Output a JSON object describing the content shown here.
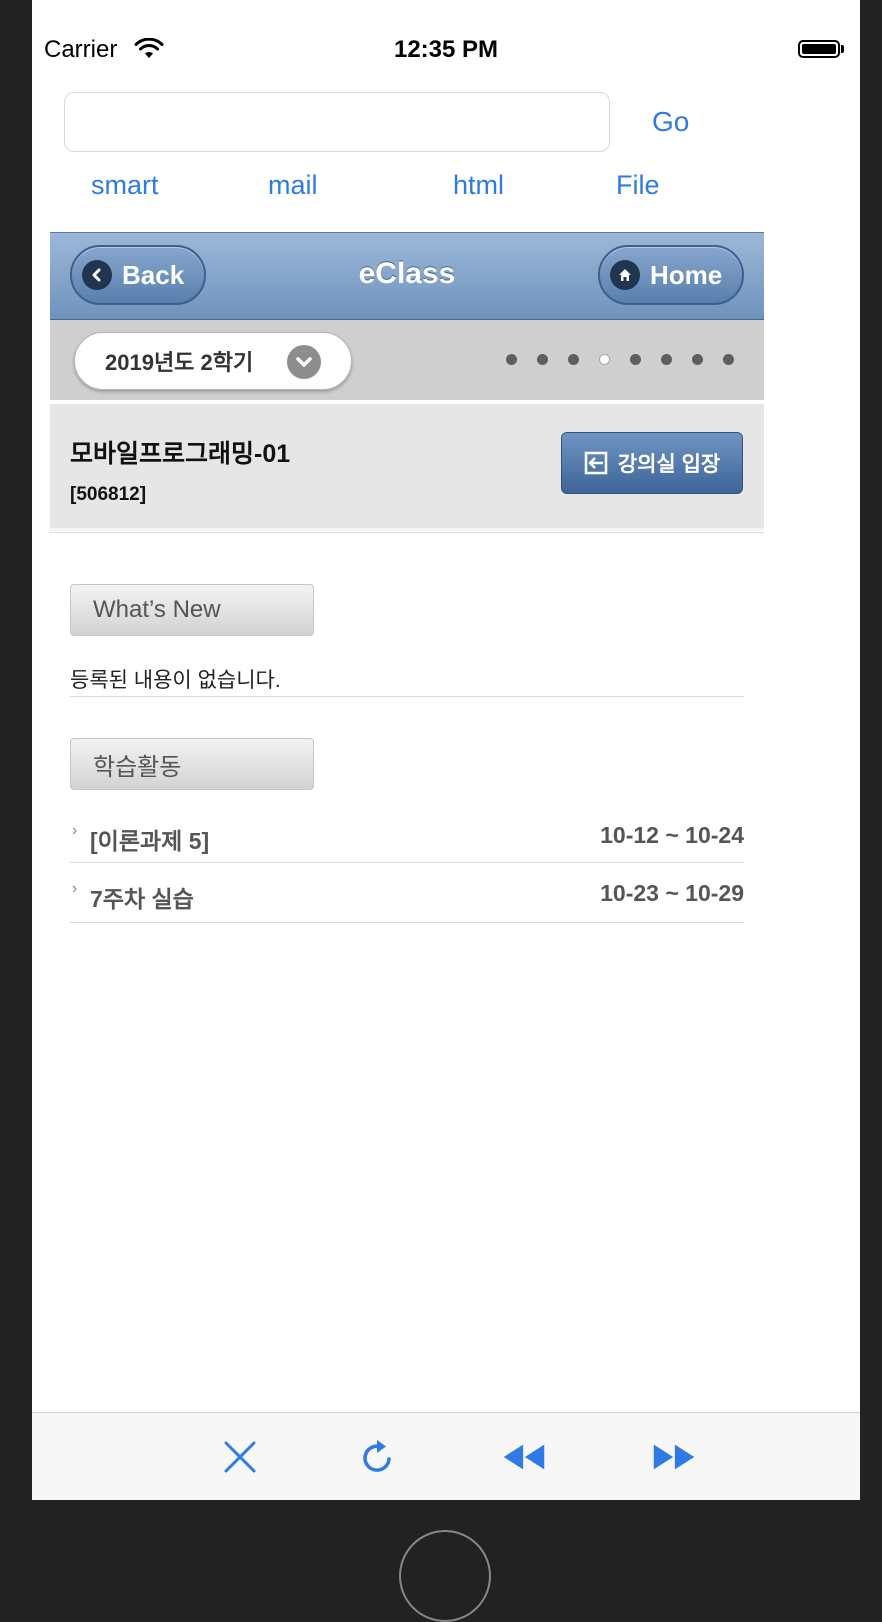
{
  "status_bar": {
    "carrier": "Carrier",
    "time": "12:35 PM"
  },
  "url_bar": {
    "value": "",
    "go_label": "Go"
  },
  "quick_links": [
    "smart",
    "mail",
    "html",
    "File"
  ],
  "nav": {
    "back_label": "Back",
    "title": "eClass",
    "home_label": "Home"
  },
  "semester": {
    "selected": "2019년도 2학기",
    "page_count": 8,
    "active_page": 4
  },
  "course": {
    "name": "모바일프로그래밍-01",
    "code": "[506812]",
    "enter_label": "강의실 입장"
  },
  "whats_new": {
    "heading": "What’s New",
    "empty_message": "등록된 내용이 없습니다."
  },
  "activities": {
    "heading": "학습활동",
    "items": [
      {
        "title": "[이론과제 5]",
        "period": "10-12 ~ 10-24"
      },
      {
        "title": "7주차 실습",
        "period": "10-23 ~ 10-29"
      }
    ]
  },
  "toolbar": {
    "icons": [
      "close-icon",
      "reload-icon",
      "rewind-icon",
      "fast-forward-icon"
    ]
  },
  "colors": {
    "link_blue": "#2f7ae5",
    "nav_blue": "#6f92bd",
    "enter_button": "#3e6597"
  }
}
